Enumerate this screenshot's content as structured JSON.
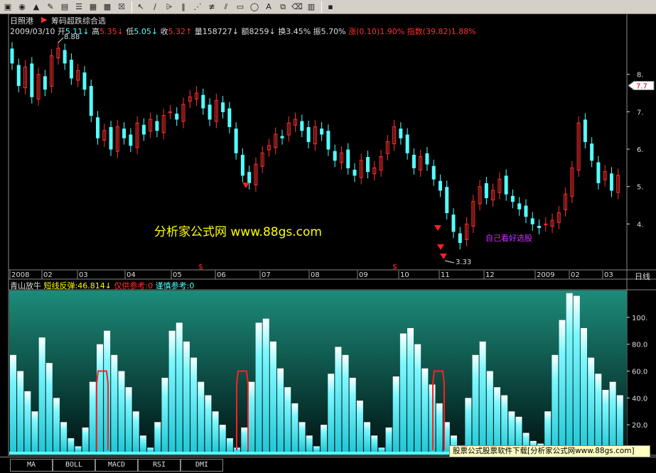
{
  "toolbar": {
    "icons": [
      "chip-icon",
      "ball-icon",
      "bell-icon",
      "pen-icon",
      "layout-icon",
      "layout-icon",
      "picture-icon",
      "grid-icon",
      "close-window-icon",
      "pointer-icon",
      "line-icon",
      "pivot-icon",
      "vertical-lines-icon",
      "fan-icon",
      "parallel-icon",
      "channel-icon",
      "rectangle-icon",
      "ellipse-icon",
      "text-icon",
      "copy-icon",
      "eraser-icon",
      "palette-icon",
      "save-icon"
    ],
    "glyphs": [
      "▣",
      "◉",
      "▲",
      "✎",
      "▤",
      "☰",
      "▦",
      "▩",
      "☒",
      "↖",
      "∕",
      "⩥",
      "‖",
      "⋰",
      "≢",
      "⫽",
      "▭",
      "◯",
      "A",
      "⧉",
      "⌫",
      "▥",
      "▪"
    ]
  },
  "stock": {
    "name": "日照港",
    "indicator_menu": "筹码超跌综合选"
  },
  "quote": {
    "date": "2009/03/10",
    "open_label": "开",
    "open": "5.11",
    "high_label": "高",
    "high": "5.35",
    "low_label": "低",
    "low": "5.05",
    "close_label": "收",
    "close": "5.32",
    "vol_label": "量",
    "vol": "158727",
    "amount_label": "额",
    "amount": "8259",
    "turnover_label": "换",
    "turnover": "3.45%",
    "amp_label": "振",
    "amp": "5.70%",
    "change_label": "涨",
    "change": "(0.10)",
    "change_pct": "1.90%",
    "index_label": "指数",
    "index_val": "(39.82)",
    "index_pct": "1.88%"
  },
  "price_axis": {
    "ticks": [
      "8.",
      "7.",
      "6.",
      "5.",
      "4."
    ],
    "current": "7.7"
  },
  "annotations": {
    "high_mark": "8.88",
    "low_mark": "3.33",
    "watermark": "分析家公式网 www.88gs.com",
    "note": "自己看好选股"
  },
  "date_axis": {
    "labels": [
      "2008",
      "02",
      "03",
      "04",
      "05",
      "06",
      "07",
      "08",
      "09",
      "10",
      "11",
      "12",
      "2009",
      "02",
      "03"
    ],
    "right_label": "日线"
  },
  "signal_marks": {
    "symbol": "$"
  },
  "indicator": {
    "name": "青山放牛",
    "line1_label": "短线反弹",
    "line1_value": "46.814",
    "line2_label": "仅供参考",
    "line2_value": "0",
    "line3_label": "谨慎参考",
    "line3_value": "0",
    "axis_ticks": [
      "100.",
      "80.0",
      "60.0",
      "40.0",
      "20.0"
    ]
  },
  "tabs": [
    "MA",
    "BOLL",
    "MACD",
    "RSI",
    "DMI"
  ],
  "promo": "股票公式股票软件下载[分析家公式网www.88gs.com]",
  "colors": {
    "up": "#ff3030",
    "down": "#54ffff",
    "label_yellow": "#ffff00",
    "teal_top": "#1c8c7a",
    "teal_bottom": "#001414",
    "bar_cyan": "#7ff7ff",
    "marker_red": "#ff2020",
    "note_magenta": "#d030ff",
    "white": "#ffffff",
    "green_text": "#00ff80"
  },
  "chart_data": [
    {
      "type": "candlestick",
      "title": "日照港 daily",
      "period": "2008-01 to 2009-03",
      "ylim": [
        3.0,
        9.0
      ],
      "high": 8.88,
      "low": 3.33,
      "last_close": 5.32,
      "close": [
        8.3,
        7.7,
        8.2,
        7.4,
        8.0,
        7.6,
        8.5,
        8.7,
        8.3,
        7.9,
        8.1,
        7.6,
        6.9,
        6.3,
        6.5,
        6.0,
        6.6,
        6.3,
        6.1,
        6.7,
        6.4,
        6.8,
        6.5,
        6.9,
        7.0,
        6.8,
        7.2,
        7.4,
        7.5,
        7.1,
        6.8,
        7.3,
        7.0,
        6.6,
        5.9,
        5.3,
        5.1,
        5.6,
        5.9,
        6.1,
        6.4,
        6.3,
        6.7,
        6.8,
        6.5,
        6.2,
        6.6,
        6.4,
        6.0,
        5.7,
        5.9,
        5.5,
        5.3,
        5.7,
        5.4,
        5.5,
        5.8,
        6.2,
        6.6,
        6.3,
        5.9,
        5.5,
        5.8,
        5.6,
        5.2,
        4.9,
        4.3,
        3.8,
        3.5,
        4.0,
        4.6,
        5.0,
        4.7,
        4.9,
        5.2,
        4.8,
        4.6,
        4.4,
        4.2,
        4.0,
        3.9,
        4.0,
        4.1,
        4.3,
        4.8,
        5.5,
        6.7,
        6.2,
        5.7,
        5.1,
        5.4,
        4.9,
        5.3
      ]
    },
    {
      "type": "bar",
      "title": "青山放牛",
      "ylim": [
        0,
        120
      ],
      "ylabel": "",
      "values": [
        72,
        60,
        45,
        30,
        85,
        66,
        40,
        22,
        10,
        4,
        18,
        52,
        80,
        90,
        72,
        60,
        48,
        30,
        12,
        3,
        22,
        55,
        90,
        96,
        82,
        70,
        52,
        42,
        30,
        20,
        10,
        3,
        18,
        52,
        96,
        99,
        82,
        62,
        48,
        36,
        22,
        12,
        4,
        20,
        58,
        78,
        72,
        55,
        38,
        22,
        12,
        3,
        18,
        56,
        88,
        92,
        80,
        62,
        50,
        36,
        22,
        12,
        3,
        40,
        72,
        82,
        60,
        48,
        42,
        30,
        26,
        14,
        8,
        6,
        30,
        72,
        98,
        118,
        116,
        92,
        70,
        58,
        46,
        52,
        42
      ]
    }
  ]
}
